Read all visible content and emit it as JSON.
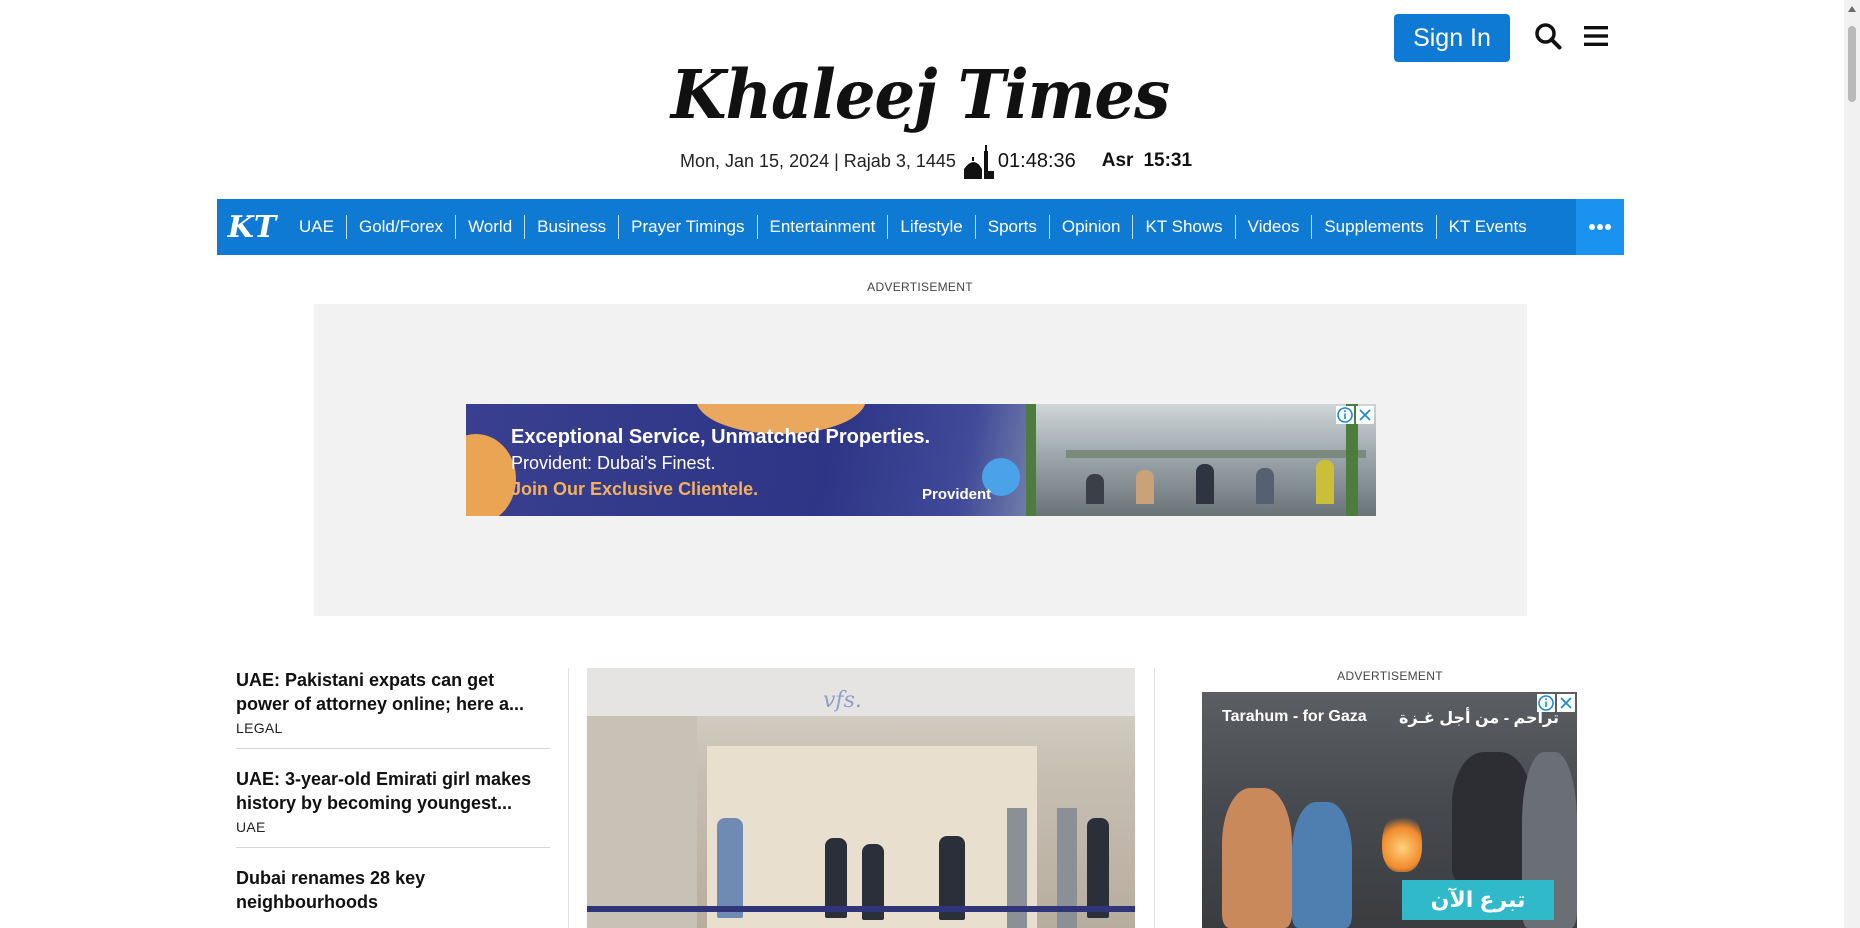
{
  "header": {
    "sign_in_label": "Sign In",
    "search_icon": "search-icon",
    "menu_icon": "hamburger-menu-icon"
  },
  "brand": {
    "logo_text": "Khaleej Times",
    "nav_logo_text": "KT",
    "primary_color": "#0f7ad3",
    "nav_more_color": "#1a93f0"
  },
  "date_bar": {
    "gregorian_date": "Mon, Jan 15, 2024",
    "separator": "|",
    "hijri_date": "Rajab 3, 1445",
    "time": "01:48:36",
    "prayer_name": "Asr",
    "prayer_time": "15:31"
  },
  "nav": {
    "items": [
      {
        "label": "UAE"
      },
      {
        "label": "Gold/Forex"
      },
      {
        "label": "World"
      },
      {
        "label": "Business"
      },
      {
        "label": "Prayer Timings"
      },
      {
        "label": "Entertainment"
      },
      {
        "label": "Lifestyle"
      },
      {
        "label": "Sports"
      },
      {
        "label": "Opinion"
      },
      {
        "label": "KT Shows"
      },
      {
        "label": "Videos"
      },
      {
        "label": "Supplements"
      },
      {
        "label": "KT Events"
      }
    ],
    "more_icon": "more-dots-icon"
  },
  "ads": {
    "label": "ADVERTISEMENT",
    "top_banner": {
      "headline": "Exceptional Service, Unmatched Properties.",
      "subline": "Provident: Dubai's Finest.",
      "cta": "Join Our Exclusive Clientele.",
      "brand": "Provident"
    },
    "right_banner": {
      "title_en": "Tarahum - for Gaza",
      "title_ar": "تراحم - من أجل غـزة",
      "cta": "تبرع الآن"
    }
  },
  "news": [
    {
      "title": "UAE: Pakistani expats can get power of attorney online; here a...",
      "tag": "LEGAL"
    },
    {
      "title": "UAE: 3-year-old Emirati girl makes history by becoming youngest...",
      "tag": "UAE"
    },
    {
      "title": "Dubai renames 28 key neighbourhoods",
      "tag": ""
    }
  ],
  "main_image": {
    "logo_text": "vfs."
  }
}
